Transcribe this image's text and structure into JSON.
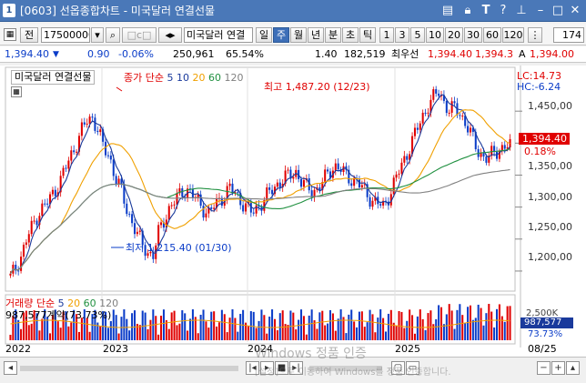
{
  "window": {
    "num": "1",
    "title": "[0603] 선옵종합차트 - 미국달러 연결선물"
  },
  "toolbar": {
    "kind": "전",
    "code": "17500000",
    "product": "미국달러 연결",
    "period_buttons": [
      "일",
      "주",
      "월",
      "년",
      "분",
      "초",
      "틱"
    ],
    "active_period": "주",
    "count_buttons": [
      "1",
      "3",
      "5",
      "10",
      "20",
      "30",
      "60",
      "120"
    ],
    "count_field": "174"
  },
  "quote": {
    "price": "1,394.40",
    "change": "0.90",
    "change_rate": "-0.06%",
    "volume": "250,961",
    "ratio": "65.54%",
    "diff": "1.40",
    "open_interest": "182,519",
    "best_ask_label": "최우선",
    "best_ask": "1,394.40",
    "best_bid": "1,394.3",
    "high_label": "A",
    "high": "1,394.00"
  },
  "chart_legend": {
    "name": "미국달러 연결선물",
    "ma_label": "종가 단순",
    "ma_periods": [
      "5",
      "10",
      "20",
      "60",
      "120"
    ]
  },
  "chart_labels": {
    "lc": "LC:14.73",
    "hc": "HC:-6.24",
    "high_annotation": "최고 1,487.20 (12/23)",
    "low_annotation": "최저 1,215.40 (01/30)",
    "current_price_tag": "1,394.40",
    "current_change": "0.18%",
    "volume_legend": "거래량  단순",
    "volume_periods": [
      "5",
      "20",
      "60",
      "120"
    ],
    "volume_info": "987,577계약(73.73%)",
    "volume_axis_top": "2,500K",
    "volume_tag": "987,577",
    "volume_pct": "73.73%"
  },
  "axes": {
    "y_ticks": [
      "1,450,00",
      "1,400,00",
      "1,350,00",
      "1,300,00",
      "1,250,00",
      "1,200,00"
    ],
    "x_ticks": [
      "2022",
      "2023",
      "2024",
      "2025",
      "08/25"
    ]
  },
  "status": {
    "watermark": "Windows 정품 인증",
    "watermark_sub": "[설정]으로 이동하여 Windows를 정품 인증합니다."
  },
  "colors": {
    "up": "#e00000",
    "down": "#0a3cc8",
    "ma5": "#1a3a9c",
    "ma10": "#e0a800",
    "ma20": "#f0a000",
    "ma60": "#209040",
    "ma120": "#808080"
  },
  "chart_data": {
    "type": "candlestick",
    "title": "미국달러 연결선물",
    "x": [
      "2022",
      "2023",
      "2024",
      "2025"
    ],
    "ylim": [
      1180,
      1510
    ],
    "y_ticks": [
      1200,
      1250,
      1300,
      1350,
      1400,
      1450
    ],
    "high": {
      "value": 1487.2,
      "date": "12/23"
    },
    "low": {
      "value": 1215.4,
      "date": "01/30"
    },
    "last": 1394.4,
    "close_path_approx": [
      1190,
      1205,
      1225,
      1250,
      1270,
      1290,
      1300,
      1310,
      1325,
      1340,
      1360,
      1380,
      1400,
      1420,
      1435,
      1440,
      1420,
      1390,
      1380,
      1350,
      1330,
      1300,
      1280,
      1260,
      1240,
      1230,
      1225,
      1260,
      1280,
      1300,
      1310,
      1320,
      1330,
      1320,
      1310,
      1300,
      1290,
      1300,
      1310,
      1320,
      1330,
      1320,
      1310,
      1300,
      1290,
      1300,
      1310,
      1320,
      1330,
      1340,
      1345,
      1350,
      1355,
      1340,
      1330,
      1325,
      1330,
      1340,
      1355,
      1365,
      1360,
      1350,
      1345,
      1340,
      1330,
      1320,
      1310,
      1305,
      1300,
      1320,
      1340,
      1360,
      1380,
      1400,
      1420,
      1440,
      1460,
      1470,
      1480,
      1465,
      1450,
      1455,
      1445,
      1430,
      1410,
      1390,
      1380,
      1375,
      1385,
      1390,
      1395,
      1394
    ]
  }
}
